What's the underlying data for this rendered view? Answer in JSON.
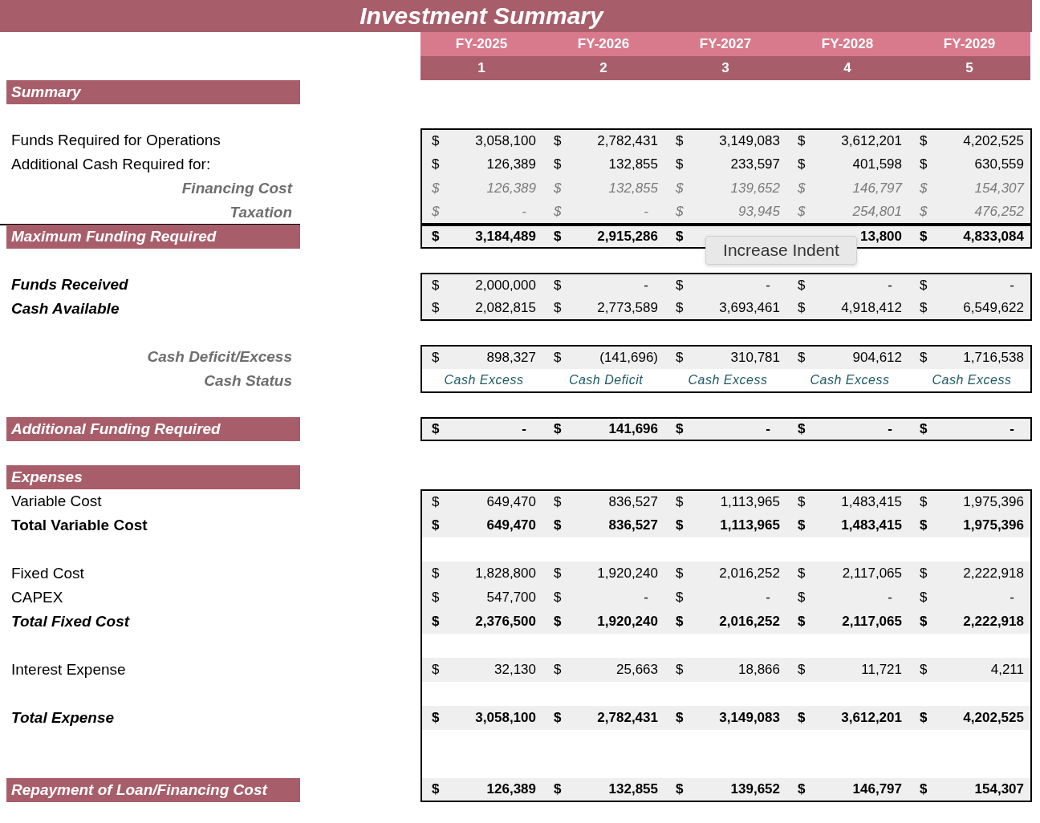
{
  "title": "Investment Summary",
  "years": [
    "FY-2025",
    "FY-2026",
    "FY-2027",
    "FY-2028",
    "FY-2029"
  ],
  "periods": [
    "1",
    "2",
    "3",
    "4",
    "5"
  ],
  "sections": [
    {
      "boxed": false,
      "rows": [
        {
          "kind": "band",
          "label": "Summary"
        },
        {
          "kind": "blank"
        }
      ]
    },
    {
      "boxed": true,
      "rows": [
        {
          "kind": "plain",
          "label": "Funds Required for Operations",
          "values": [
            {
              "currency": "$",
              "amount": "3,058,100"
            },
            {
              "currency": "$",
              "amount": "2,782,431"
            },
            {
              "currency": "$",
              "amount": "3,149,083"
            },
            {
              "currency": "$",
              "amount": "3,612,201"
            },
            {
              "currency": "$",
              "amount": "4,202,525"
            }
          ]
        },
        {
          "kind": "plain",
          "label": "Additional Cash Required for:",
          "values": [
            {
              "currency": "$",
              "amount": "126,389"
            },
            {
              "currency": "$",
              "amount": "132,855"
            },
            {
              "currency": "$",
              "amount": "233,597"
            },
            {
              "currency": "$",
              "amount": "401,598"
            },
            {
              "currency": "$",
              "amount": "630,559"
            }
          ]
        },
        {
          "kind": "sub",
          "label": "Financing Cost",
          "values": [
            {
              "currency": "$",
              "amount": "126,389"
            },
            {
              "currency": "$",
              "amount": "132,855"
            },
            {
              "currency": "$",
              "amount": "139,652"
            },
            {
              "currency": "$",
              "amount": "146,797"
            },
            {
              "currency": "$",
              "amount": "154,307"
            }
          ]
        },
        {
          "kind": "sub",
          "label": "Taxation",
          "values": [
            {
              "currency": "$",
              "amount": "-"
            },
            {
              "currency": "$",
              "amount": "-"
            },
            {
              "currency": "$",
              "amount": "93,945"
            },
            {
              "currency": "$",
              "amount": "254,801"
            },
            {
              "currency": "$",
              "amount": "476,252"
            }
          ]
        }
      ]
    },
    {
      "boxed": true,
      "rows": [
        {
          "kind": "band",
          "label": "Maximum Funding Required",
          "rule_above": true,
          "values": [
            {
              "currency": "$",
              "amount": "3,184,489"
            },
            {
              "currency": "$",
              "amount": "2,915,286"
            },
            {
              "currency": "$"
            },
            {
              "amount": "13,800"
            },
            {
              "currency": "$",
              "amount": "4,833,084"
            }
          ]
        }
      ]
    },
    {
      "boxed": false,
      "rows": [
        {
          "kind": "blank"
        }
      ]
    },
    {
      "boxed": true,
      "rows": [
        {
          "kind": "emph",
          "label": "Funds Received",
          "values": [
            {
              "currency": "$",
              "amount": "2,000,000"
            },
            {
              "currency": "$",
              "amount": "-"
            },
            {
              "currency": "$",
              "amount": "-"
            },
            {
              "currency": "$",
              "amount": "-"
            },
            {
              "currency": "$",
              "amount": "-"
            }
          ]
        },
        {
          "kind": "emph",
          "label": "Cash Available",
          "values": [
            {
              "currency": "$",
              "amount": "2,082,815"
            },
            {
              "currency": "$",
              "amount": "2,773,589"
            },
            {
              "currency": "$",
              "amount": "3,693,461"
            },
            {
              "currency": "$",
              "amount": "4,918,412"
            },
            {
              "currency": "$",
              "amount": "6,549,622"
            }
          ]
        }
      ]
    },
    {
      "boxed": false,
      "rows": [
        {
          "kind": "blank"
        }
      ]
    },
    {
      "boxed": true,
      "rows": [
        {
          "kind": "sub-plain",
          "label": "Cash Deficit/Excess",
          "values": [
            {
              "currency": "$",
              "amount": "898,327"
            },
            {
              "currency": "$",
              "amount": "(141,696)"
            },
            {
              "currency": "$",
              "amount": "310,781"
            },
            {
              "currency": "$",
              "amount": "904,612"
            },
            {
              "currency": "$",
              "amount": "1,716,538"
            }
          ]
        },
        {
          "kind": "status",
          "label": "Cash Status",
          "values": [
            {
              "status": "Cash Excess"
            },
            {
              "status": "Cash Deficit"
            },
            {
              "status": "Cash Excess"
            },
            {
              "status": "Cash Excess"
            },
            {
              "status": "Cash Excess"
            }
          ]
        }
      ]
    },
    {
      "boxed": false,
      "rows": [
        {
          "kind": "blank"
        }
      ]
    },
    {
      "boxed": true,
      "rows": [
        {
          "kind": "band",
          "label": "Additional Funding Required",
          "values": [
            {
              "currency": "$",
              "amount": "-"
            },
            {
              "currency": "$",
              "amount": "141,696"
            },
            {
              "currency": "$",
              "amount": "-"
            },
            {
              "currency": "$",
              "amount": "-"
            },
            {
              "currency": "$",
              "amount": "-"
            }
          ]
        }
      ]
    },
    {
      "boxed": false,
      "rows": [
        {
          "kind": "blank"
        },
        {
          "kind": "band",
          "label": "Expenses"
        }
      ]
    },
    {
      "boxed": true,
      "rows": [
        {
          "kind": "plain",
          "label": "Variable Cost",
          "values": [
            {
              "currency": "$",
              "amount": "649,470"
            },
            {
              "currency": "$",
              "amount": "836,527"
            },
            {
              "currency": "$",
              "amount": "1,113,965"
            },
            {
              "currency": "$",
              "amount": "1,483,415"
            },
            {
              "currency": "$",
              "amount": "1,975,396"
            }
          ]
        },
        {
          "kind": "total",
          "label": "Total Variable Cost",
          "values": [
            {
              "currency": "$",
              "amount": "649,470"
            },
            {
              "currency": "$",
              "amount": "836,527"
            },
            {
              "currency": "$",
              "amount": "1,113,965"
            },
            {
              "currency": "$",
              "amount": "1,483,415"
            },
            {
              "currency": "$",
              "amount": "1,975,396"
            }
          ]
        },
        {
          "kind": "blank"
        },
        {
          "kind": "plain",
          "label": "Fixed Cost",
          "values": [
            {
              "currency": "$",
              "amount": "1,828,800"
            },
            {
              "currency": "$",
              "amount": "1,920,240"
            },
            {
              "currency": "$",
              "amount": "2,016,252"
            },
            {
              "currency": "$",
              "amount": "2,117,065"
            },
            {
              "currency": "$",
              "amount": "2,222,918"
            }
          ]
        },
        {
          "kind": "plain",
          "label": "CAPEX",
          "values": [
            {
              "currency": "$",
              "amount": "547,700"
            },
            {
              "currency": "$",
              "amount": "-"
            },
            {
              "currency": "$",
              "amount": "-"
            },
            {
              "currency": "$",
              "amount": "-"
            },
            {
              "currency": "$",
              "amount": "-"
            }
          ]
        },
        {
          "kind": "total-italic",
          "label": "Total Fixed Cost",
          "values": [
            {
              "currency": "$",
              "amount": "2,376,500"
            },
            {
              "currency": "$",
              "amount": "1,920,240"
            },
            {
              "currency": "$",
              "amount": "2,016,252"
            },
            {
              "currency": "$",
              "amount": "2,117,065"
            },
            {
              "currency": "$",
              "amount": "2,222,918"
            }
          ]
        },
        {
          "kind": "blank"
        },
        {
          "kind": "plain",
          "label": "Interest Expense",
          "values": [
            {
              "currency": "$",
              "amount": "32,130"
            },
            {
              "currency": "$",
              "amount": "25,663"
            },
            {
              "currency": "$",
              "amount": "18,866"
            },
            {
              "currency": "$",
              "amount": "11,721"
            },
            {
              "currency": "$",
              "amount": "4,211"
            }
          ]
        },
        {
          "kind": "blank"
        },
        {
          "kind": "total-italic",
          "label": "Total Expense",
          "values": [
            {
              "currency": "$",
              "amount": "3,058,100"
            },
            {
              "currency": "$",
              "amount": "2,782,431"
            },
            {
              "currency": "$",
              "amount": "3,149,083"
            },
            {
              "currency": "$",
              "amount": "3,612,201"
            },
            {
              "currency": "$",
              "amount": "4,202,525"
            }
          ]
        },
        {
          "kind": "blank"
        },
        {
          "kind": "blank"
        },
        {
          "kind": "band",
          "label": "Repayment of Loan/Financing Cost",
          "values": [
            {
              "currency": "$",
              "amount": "126,389"
            },
            {
              "currency": "$",
              "amount": "132,855"
            },
            {
              "currency": "$",
              "amount": "139,652"
            },
            {
              "currency": "$",
              "amount": "146,797"
            },
            {
              "currency": "$",
              "amount": "154,307"
            }
          ]
        }
      ]
    }
  ],
  "tooltip": {
    "text": "Increase Indent"
  }
}
